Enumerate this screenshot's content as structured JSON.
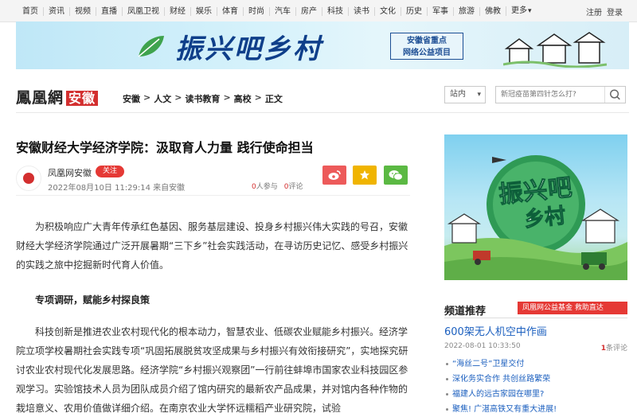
{
  "nav": {
    "links": [
      "首页",
      "资讯",
      "视频",
      "直播",
      "凤凰卫视",
      "财经",
      "娱乐",
      "体育",
      "时尚",
      "汽车",
      "房产",
      "科技",
      "读书",
      "文化",
      "历史",
      "军事",
      "旅游",
      "佛教"
    ],
    "more": "更多",
    "login": "注册",
    "register": "登录"
  },
  "banner": {
    "title": "振兴吧乡村",
    "subtitle_line1": "安徽省重点",
    "subtitle_line2": "网络公益项目"
  },
  "header": {
    "logo": "鳳凰網",
    "region": "安徽",
    "breadcrumb": [
      "安徽",
      "人文",
      "读书教育",
      "高校",
      "正文"
    ],
    "breadcrumb_sep": ">",
    "station_label": "站内",
    "search_placeholder": "新冠疫苗第四针怎么打?"
  },
  "article": {
    "title": "安徽财经大学经济学院：汲取育人力量 践行使命担当",
    "author": "凤凰网安徽",
    "follow": "关注",
    "avatar_text": "凤凰网安徽",
    "date": "2022年08月10日 11:29:14 来自安徽",
    "participants_count": "0",
    "participants_label": "人参与",
    "comments_count": "0",
    "comments_label": "评论",
    "p1": "为积极响应广大青年传承红色基因、服务基层建设、投身乡村振兴伟大实践的号召，安徽财经大学经济学院通过广泛开展暑期“三下乡”社会实践活动，在寻访历史记忆、感受乡村振兴的实践之旅中挖掘新时代育人价值。",
    "subheading": "专项调研，赋能乡村探良策",
    "p2": "科技创新是推进农业农村现代化的根本动力，智慧农业、低碳农业赋能乡村振兴。经济学院立项学校暑期社会实践专项“巩固拓展脱贫攻坚成果与乡村振兴有效衔接研究”，实地探究研讨农业农村现代化发展思路。经济学院“乡村振兴观察团”一行前往蚌埠市国家农业科技园区参观学习。实验馆技术人员为团队成员介绍了馆内研究的最新农产品成果，并对馆内各种作物的栽培意义、农用价值做详细介绍。在南京农业大学怀远糯稻产业研究院，试验"
  },
  "sidebar": {
    "promo_title_1": "振兴吧",
    "promo_title_2": "乡村",
    "channel_title": "频道推荐",
    "ad_text": "凤凰网公益基金  救助直达",
    "featured_title": "600架无人机空中作画",
    "featured_date": "2022-08-01 10:33:50",
    "featured_comments": "1",
    "featured_comments_label": "条评论",
    "related": [
      "“海丝二号”卫星交付",
      "深化务实合作 共创丝路繁荣",
      "福建人的远古家园在哪里?",
      "聚焦! 广湛高铁又有重大进展!"
    ]
  },
  "colors": {
    "accent": "#d32f2f",
    "link": "#1b5fbf"
  }
}
